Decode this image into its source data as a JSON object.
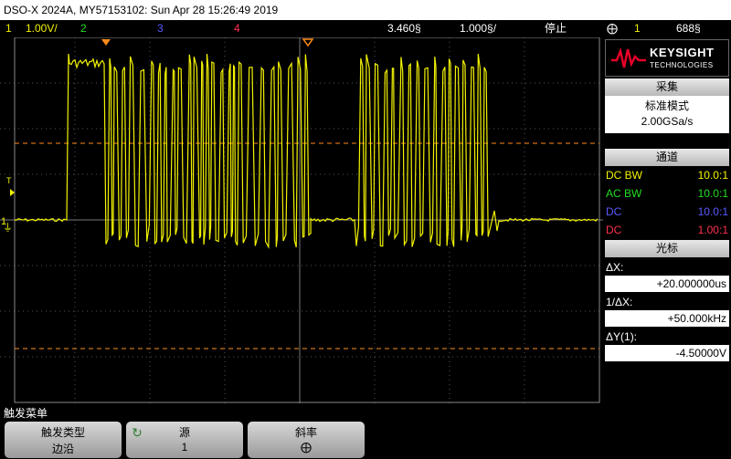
{
  "title_bar": {
    "text": "DSO-X 2024A, MY57153102: Sun Apr 28 15:26:49 2019"
  },
  "status": {
    "ch1_num": "1",
    "ch1_scale": "1.00V/",
    "ch2_num": "2",
    "ch3_num": "3",
    "ch4_num": "4",
    "time_delay": "3.460§",
    "time_scale": "1.000§/",
    "run_state": "停止",
    "trigger_slope": "⨁",
    "trigger_src": "1",
    "trigger_level": "688§"
  },
  "colors": {
    "ch1": "#f2f200",
    "ch2": "#22dd22",
    "ch3": "#5a5aff",
    "ch4": "#ff3050",
    "cursor": "#ff8c1a"
  },
  "panel": {
    "brand": "KEYSIGHT",
    "brand_sub": "TECHNOLOGIES",
    "acq_header": "采集",
    "acq_mode": "标准模式",
    "acq_rate": "2.00GSa/s",
    "chan_header": "通道",
    "channels": [
      {
        "coupling": "DC BW",
        "probe": "10.0:1",
        "color": "#f2f200"
      },
      {
        "coupling": "AC BW",
        "probe": "10.0:1",
        "color": "#22dd22"
      },
      {
        "coupling": "DC",
        "probe": "10.0:1",
        "color": "#5a5aff"
      },
      {
        "coupling": "DC",
        "probe": "1.00:1",
        "color": "#ff3050"
      }
    ],
    "cursor_header": "光标",
    "dx_label": "ΔX:",
    "dx_value": "+20.000000us",
    "inv_label": "1/ΔX:",
    "inv_value": "+50.000kHz",
    "dy_label": "ΔY(1):",
    "dy_value": "-4.50000V"
  },
  "softkeys": {
    "menu_name": "触发菜单",
    "keys": [
      {
        "title": "触发类型",
        "value": "边沿"
      },
      {
        "title": "源",
        "value": "1"
      },
      {
        "title": "斜率",
        "value": "⨁"
      }
    ]
  },
  "screen": {
    "ground_marker": "1",
    "trigger_marker": "T"
  }
}
